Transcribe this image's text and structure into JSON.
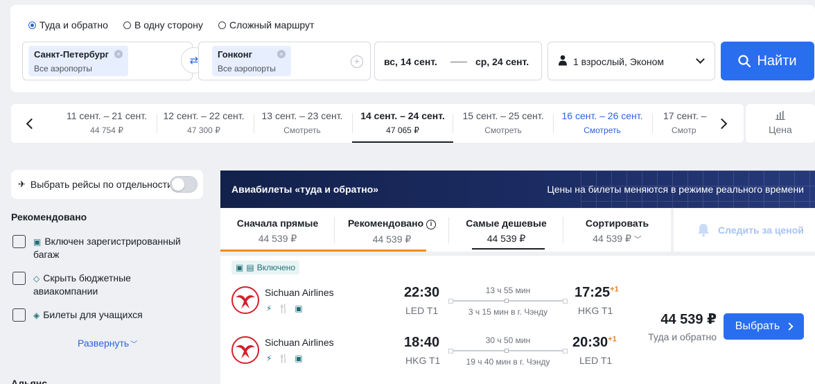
{
  "search": {
    "trip_types": [
      {
        "label": "Туда и обратно",
        "checked": true
      },
      {
        "label": "В одну сторону",
        "checked": false
      },
      {
        "label": "Сложный маршрут",
        "checked": false
      }
    ],
    "origin": {
      "city": "Санкт-Петербург",
      "airports": "Все аэропорты"
    },
    "destination": {
      "city": "Гонконг",
      "airports": "Все аэропорты"
    },
    "date_from": "вс, 14 сент.",
    "date_to": "ср, 24 сент.",
    "passengers": "1 взрослый, Эконом",
    "find_label": "Найти"
  },
  "carousel": {
    "items": [
      {
        "dates": "11 сент. – 21 сент.",
        "price": "44 754 ₽"
      },
      {
        "dates": "12 сент. – 22 сент.",
        "price": "47 300 ₽"
      },
      {
        "dates": "13 сент. – 23 сент.",
        "price": "Смотреть"
      },
      {
        "dates": "14 сент. – 24 сент.",
        "price": "47 065 ₽"
      },
      {
        "dates": "15 сент. – 25 сент.",
        "price": "Смотреть"
      },
      {
        "dates": "16 сент. – 26 сент.",
        "price": "Смотреть"
      },
      {
        "dates": "17 сент. –",
        "price": "Смотр"
      }
    ],
    "price_chart_label": "Цена"
  },
  "filters": {
    "separate_flights_label": "Выбрать рейсы по отдельности",
    "recommended_title": "Рекомендовано",
    "options": [
      {
        "label": "Включен зарегистрированный багаж"
      },
      {
        "label": "Скрыть бюджетные авиакомпании"
      },
      {
        "label": "Билеты для учащихся"
      }
    ],
    "expand_label": "Развернуть",
    "airlines_title": "Альянс"
  },
  "results": {
    "banner_title": "Авиабилеты «туда и обратно»",
    "banner_note": "Цены на билеты меняются в режиме реального времени",
    "sort_tabs": [
      {
        "name": "Сначала прямые",
        "value": "44 539 ₽"
      },
      {
        "name": "Рекомендовано",
        "value": "44 539 ₽"
      },
      {
        "name": "Самые дешевые",
        "value": "44 539 ₽"
      },
      {
        "name": "Сортировать",
        "value": "44 539 ₽"
      }
    ],
    "watch_price_label": "Следить за ценой",
    "ticket": {
      "included_label": "Включено",
      "price": "44 539 ₽",
      "price_sub": "Туда и обратно",
      "choose_label": "Выбрать",
      "legs": [
        {
          "airline": "Sichuan Airlines",
          "dep_time": "22:30",
          "dep_code": "LED T1",
          "duration": "13 ч 55 мин",
          "layover": "3 ч 15 мин в г. Чэнду",
          "arr_time": "17:25",
          "arr_plus": "+1",
          "arr_code": "HKG T1"
        },
        {
          "airline": "Sichuan Airlines",
          "dep_time": "18:40",
          "dep_code": "HKG T1",
          "duration": "30 ч 50 мин",
          "layover": "19 ч 40 мин в г. Чэнду",
          "arr_time": "20:30",
          "arr_plus": "+1",
          "arr_code": "LED T1"
        }
      ]
    }
  },
  "colors": {
    "accent": "#2a6ef0",
    "active_tab": "#f08c1e",
    "banner": "#1b2b61"
  }
}
